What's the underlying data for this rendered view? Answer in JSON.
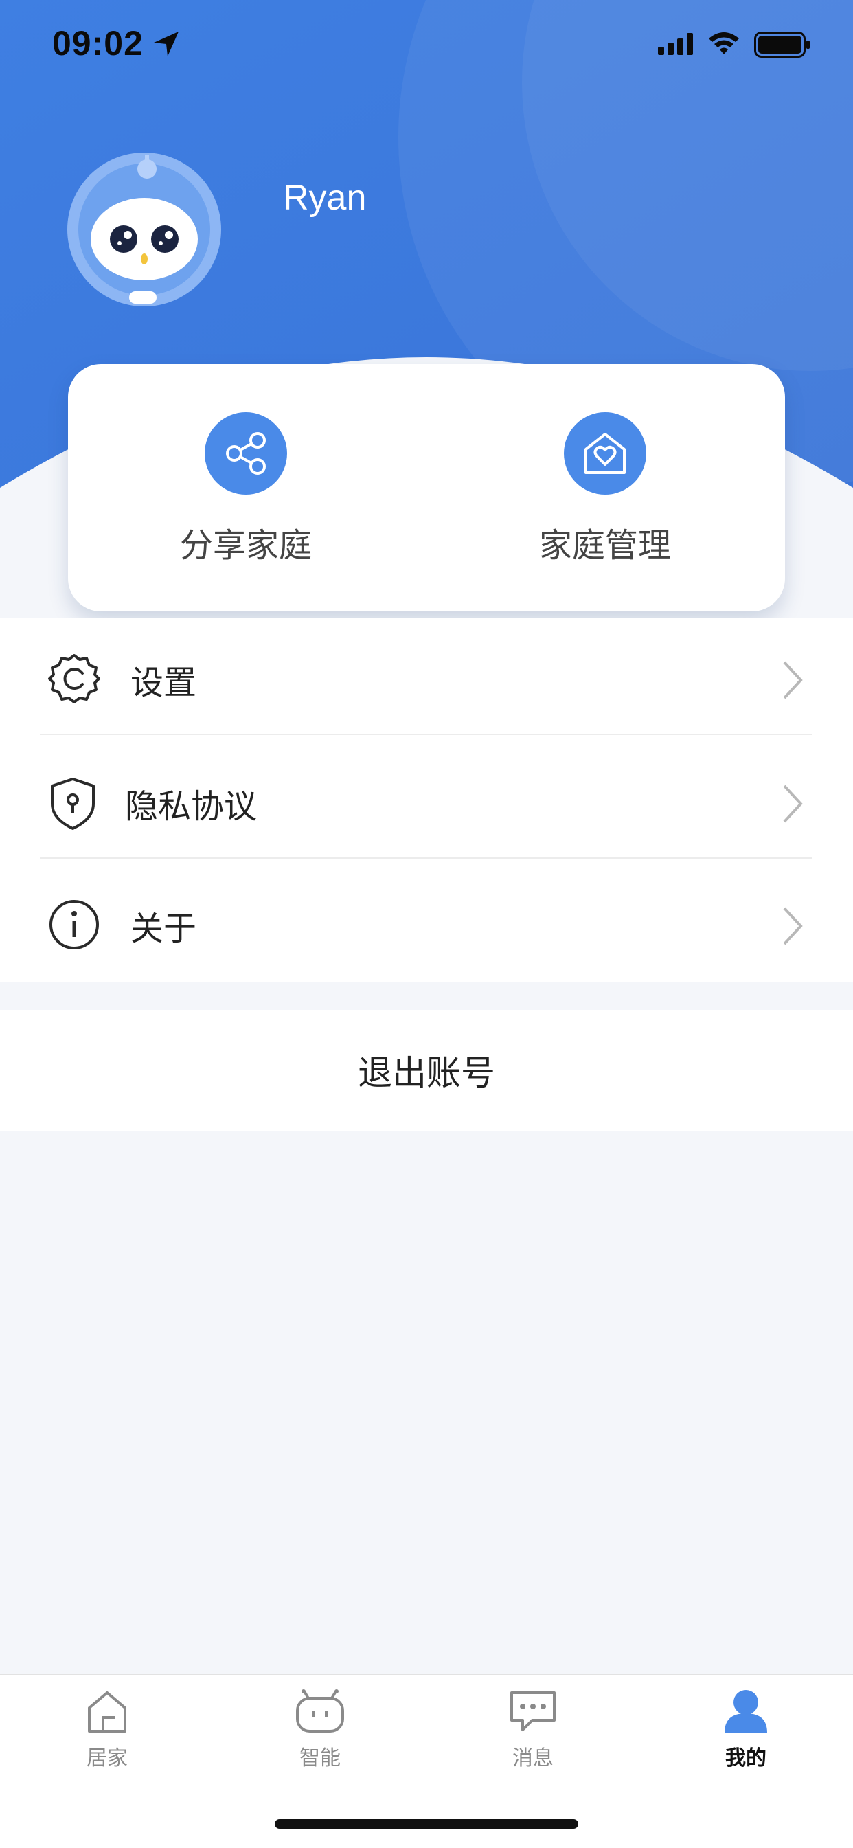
{
  "status_bar": {
    "time": "09:02"
  },
  "profile": {
    "username": "Ryan"
  },
  "quick_actions": [
    {
      "label": "分享家庭",
      "icon": "share-icon"
    },
    {
      "label": "家庭管理",
      "icon": "home-heart-icon"
    }
  ],
  "menu": [
    {
      "label": "设置",
      "icon": "gear-icon"
    },
    {
      "label": "隐私协议",
      "icon": "shield-key-icon"
    },
    {
      "label": "关于",
      "icon": "info-icon"
    }
  ],
  "logout_label": "退出账号",
  "tabs": [
    {
      "label": "居家",
      "icon": "home-icon",
      "active": false
    },
    {
      "label": "智能",
      "icon": "robot-icon",
      "active": false
    },
    {
      "label": "消息",
      "icon": "message-icon",
      "active": false
    },
    {
      "label": "我的",
      "icon": "person-icon",
      "active": true
    }
  ],
  "colors": {
    "brand_blue": "#3d7be0",
    "accent": "#4a8ae8",
    "background": "#f4f6fa"
  }
}
